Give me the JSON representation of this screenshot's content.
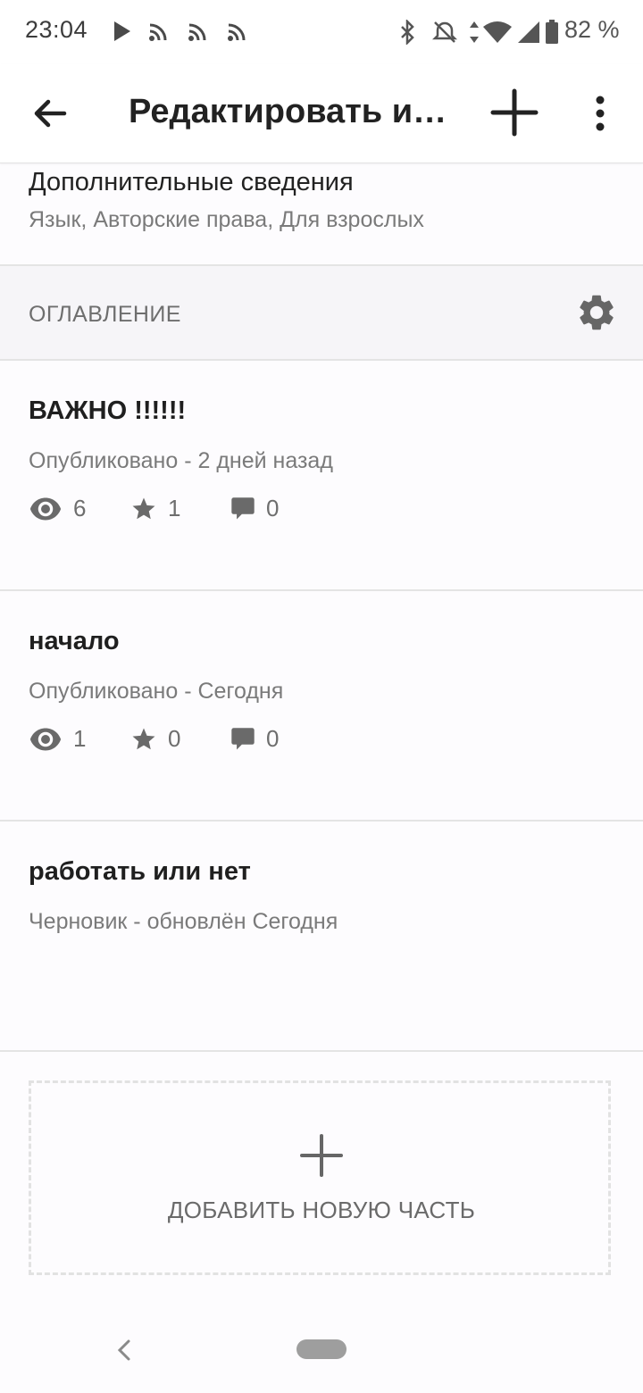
{
  "status_bar": {
    "time": "23:04",
    "battery": "82 %",
    "icons": [
      "play-icon",
      "cast-icon",
      "cast-icon",
      "cast-icon",
      "bluetooth-icon",
      "notifications-off-icon",
      "data-arrows-icon",
      "wifi-icon",
      "signal-icon",
      "battery-icon"
    ]
  },
  "app_bar": {
    "title": "Редактировать и…",
    "icons": [
      "arrow-back-icon",
      "plus-icon",
      "more-vert-icon"
    ]
  },
  "extra_info": {
    "title": "Дополнительные сведения",
    "subtitle": "Язык, Авторские права, Для взрослых"
  },
  "toc": {
    "title": "ОГЛАВЛЕНИЕ",
    "icon": "gear-icon"
  },
  "parts": [
    {
      "title": "ВАЖНО !!!!!!",
      "status": "Опубликовано - 2 дней назад",
      "views": "6",
      "votes": "1",
      "comments": "0"
    },
    {
      "title": "начало",
      "status": "Опубликовано - Сегодня",
      "views": "1",
      "votes": "0",
      "comments": "0"
    },
    {
      "title": "работать или нет",
      "status": "Черновик - обновлён Сегодня"
    }
  ],
  "add_part": {
    "label": "ДОБАВИТЬ НОВУЮ ЧАСТЬ"
  },
  "colors": {
    "background": "#fdfcfe",
    "text_primary": "#222222",
    "text_secondary": "#7a7a7a",
    "icon": "#6e6e6e",
    "divider": "#e4e4e4"
  }
}
